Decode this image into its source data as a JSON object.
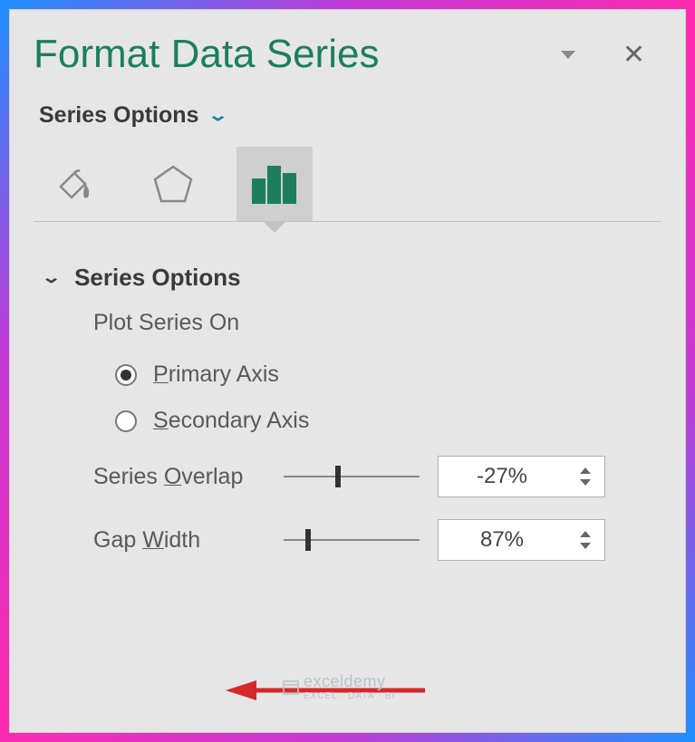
{
  "header": {
    "title": "Format Data Series"
  },
  "subheader": {
    "label": "Series Options"
  },
  "tabs": {
    "fill_icon": "paint-bucket",
    "effects_icon": "pentagon",
    "series_icon": "bar-chart"
  },
  "section": {
    "title": "Series Options",
    "plot_on_label": "Plot Series On",
    "radio_primary": "Primary Axis",
    "radio_secondary": "Secondary Axis",
    "overlap_label": "Series Overlap",
    "overlap_value": "-27%",
    "gap_label": "Gap Width",
    "gap_value": "87%"
  },
  "watermark": {
    "main": "exceldemy",
    "sub": "EXCEL · DATA · BI"
  }
}
